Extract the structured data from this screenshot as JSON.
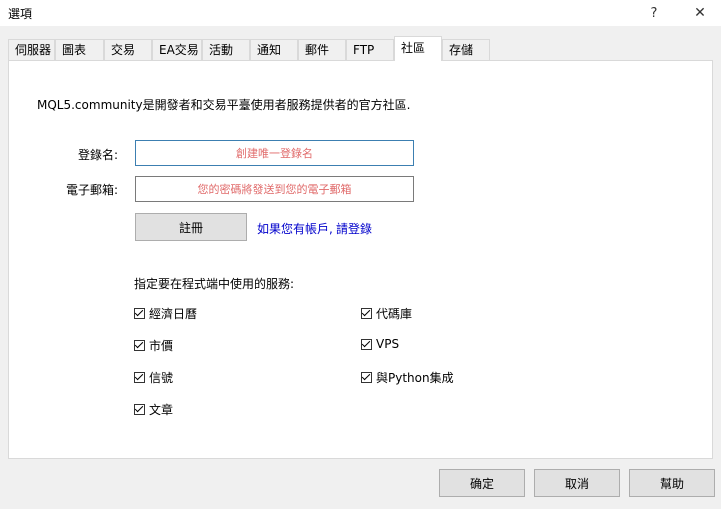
{
  "window": {
    "title": "選項",
    "help_glyph": "?",
    "close_glyph": "✕"
  },
  "tabs": [
    {
      "label": "伺服器",
      "active": false
    },
    {
      "label": "圖表",
      "active": false
    },
    {
      "label": "交易",
      "active": false
    },
    {
      "label": "EA交易",
      "active": false
    },
    {
      "label": "活動",
      "active": false
    },
    {
      "label": "通知",
      "active": false
    },
    {
      "label": "郵件",
      "active": false
    },
    {
      "label": "FTP",
      "active": false
    },
    {
      "label": "社區",
      "active": true
    },
    {
      "label": "存儲",
      "active": false
    }
  ],
  "community": {
    "intro": "MQL5.community是開發者和交易平臺使用者服務提供者的官方社區.",
    "login_label": "登錄名:",
    "login_placeholder": "創建唯一登錄名",
    "email_label": "電子郵箱:",
    "email_placeholder": "您的密碼將發送到您的電子郵箱",
    "register_button": "註冊",
    "login_link_prefix": "如果您有帳戶, ",
    "login_link": "請登錄",
    "services_title": "指定要在程式端中使用的服務:",
    "services_left": [
      {
        "label": "經濟日曆",
        "checked": true
      },
      {
        "label": "市價",
        "checked": true
      },
      {
        "label": "信號",
        "checked": true
      },
      {
        "label": "文章",
        "checked": true
      }
    ],
    "services_right": [
      {
        "label": "代碼庫",
        "checked": true
      },
      {
        "label": "VPS",
        "checked": true
      },
      {
        "label": "與Python集成",
        "checked": true
      }
    ]
  },
  "footer": {
    "ok": "确定",
    "cancel": "取消",
    "help": "幫助"
  }
}
